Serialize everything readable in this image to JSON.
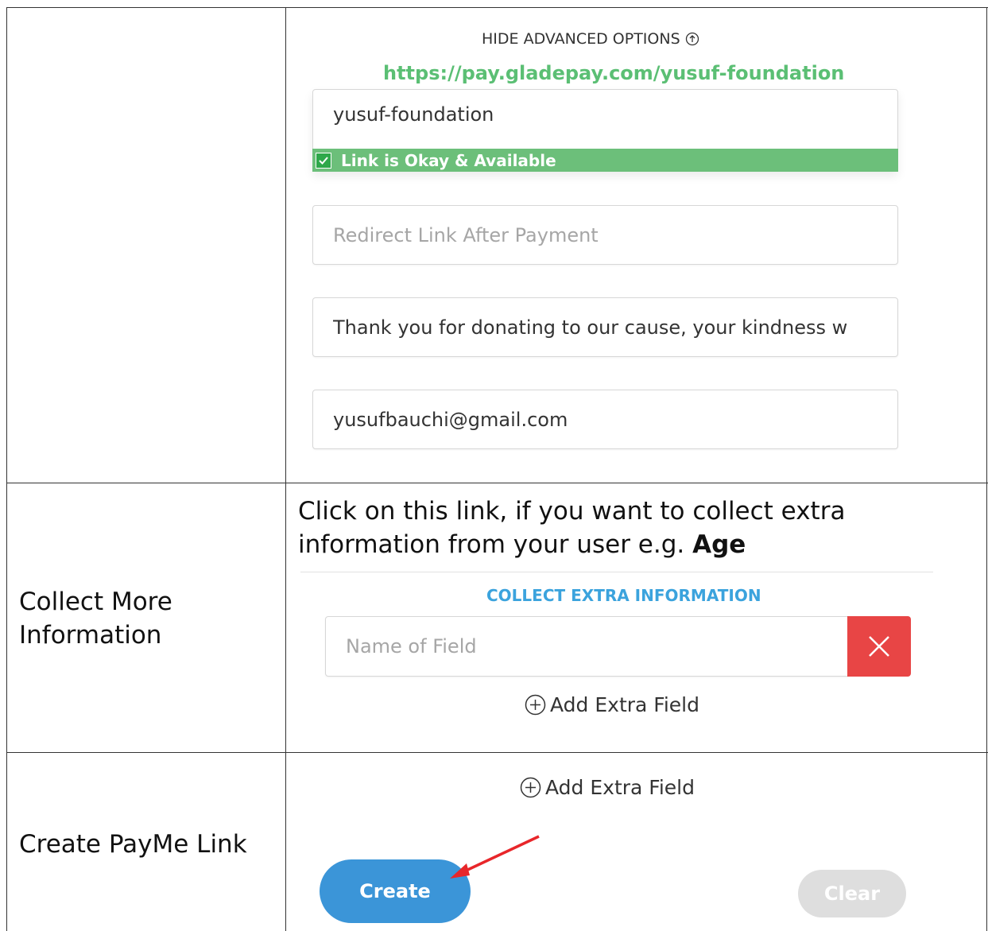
{
  "advanced": {
    "hide_label": "HIDE ADVANCED OPTIONS",
    "url": "https://pay.gladepay.com/yusuf-foundation",
    "slug_value": "yusuf-foundation",
    "link_status": "Link is Okay & Available",
    "redirect_placeholder": "Redirect Link After Payment",
    "message_value": "Thank you for donating to our cause, your kindness w",
    "email_value": "yusufbauchi@gmail.com"
  },
  "collect": {
    "row_label_line1": "Collect More",
    "row_label_line2": "Information",
    "description_line1": "Click on this link, if you want to collect extra",
    "description_line2_prefix": "information from your user e.g.",
    "description_bold": "Age",
    "section_title": "COLLECT EXTRA INFORMATION",
    "field_placeholder": "Name of Field",
    "add_field_label": "Add Extra Field"
  },
  "create_row": {
    "row_label": "Create PayMe Link",
    "add_field_label": "Add Extra Field",
    "create_label": "Create",
    "clear_label": "Clear"
  },
  "colors": {
    "green": "#6cbf7a",
    "blue": "#3b95d8",
    "red": "#e84545",
    "link_green": "#5bbf74"
  }
}
